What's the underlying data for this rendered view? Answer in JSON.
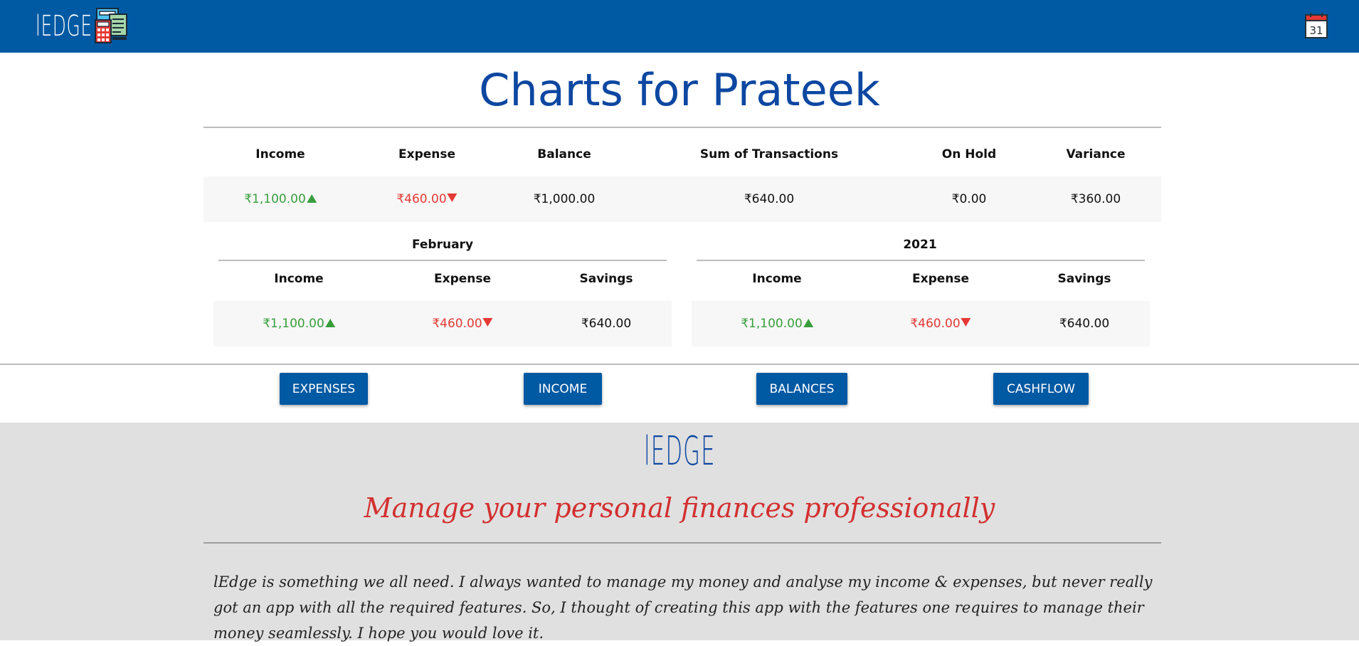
{
  "navbar": {
    "brand": "lEDGE",
    "brand_icon": "calculator-ledger-icon",
    "calendar_icon": "calendar-icon",
    "calendar_day": "31",
    "bg_color": "#0059a3"
  },
  "title": "Charts for Prateek",
  "summary": {
    "headers": [
      "Income",
      "Expense",
      "Balance",
      "Sum of Transactions",
      "On Hold",
      "Variance"
    ],
    "values": [
      "₹1,100.00",
      "₹460.00",
      "₹1,000.00",
      "₹640.00",
      "₹0.00",
      "₹360.00"
    ]
  },
  "monthly": {
    "title": "February",
    "headers": [
      "Income",
      "Expense",
      "Savings"
    ],
    "values": [
      "₹1,100.00",
      "₹460.00",
      "₹640.00"
    ]
  },
  "yearly": {
    "title": "2021",
    "headers": [
      "Income",
      "Expense",
      "Savings"
    ],
    "values": [
      "₹1,100.00",
      "₹460.00",
      "₹640.00"
    ]
  },
  "buttons": {
    "expenses": "Expenses",
    "income": "Income",
    "balances": "Balances",
    "cashflow": "Cashflow"
  },
  "footer": {
    "brand": "lEDGE",
    "tagline": "Manage your personal finances professionally",
    "about": "lEdge is something we all need. I always wanted to manage my money and analyse my income & expenses, but never really got an app with all the required features. So, I thought of creating this app with the features one requires to manage their money seamlessly. I hope you would love it."
  },
  "colors": {
    "primary": "#0059a3",
    "title": "#0d47a1",
    "income": "#389e3c",
    "expense": "#e53935",
    "footer_bg": "#e0e0e0"
  }
}
